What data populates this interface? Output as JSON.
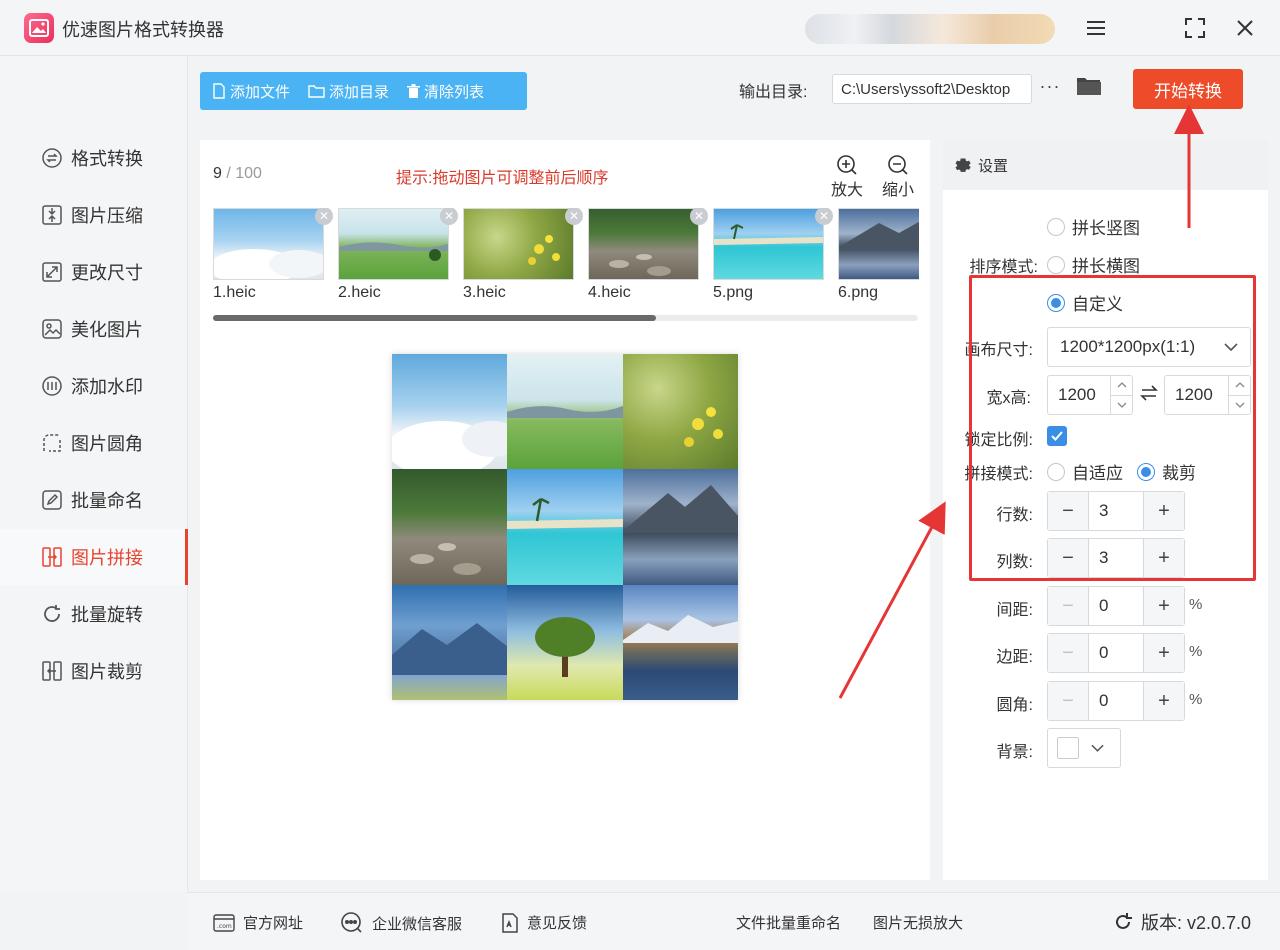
{
  "app": {
    "title": "优速图片格式转换器"
  },
  "sidebar": {
    "items": [
      {
        "label": "格式转换",
        "icon": "format-convert-icon"
      },
      {
        "label": "图片压缩",
        "icon": "compress-icon"
      },
      {
        "label": "更改尺寸",
        "icon": "resize-icon"
      },
      {
        "label": "美化图片",
        "icon": "beautify-icon"
      },
      {
        "label": "添加水印",
        "icon": "watermark-icon"
      },
      {
        "label": "图片圆角",
        "icon": "round-corner-icon"
      },
      {
        "label": "批量命名",
        "icon": "rename-icon"
      },
      {
        "label": "图片拼接",
        "icon": "stitch-icon",
        "active": true
      },
      {
        "label": "批量旋转",
        "icon": "rotate-icon"
      },
      {
        "label": "图片裁剪",
        "icon": "crop-icon"
      }
    ]
  },
  "toolbar": {
    "add_file": "添加文件",
    "add_dir": "添加目录",
    "clear_list": "清除列表"
  },
  "output": {
    "label": "输出目录:",
    "path": "C:\\Users\\yssoft2\\Desktop",
    "more": "···",
    "start": "开始转换"
  },
  "main": {
    "count": "9",
    "total": "100",
    "separator": " / ",
    "hint": "提示:拖动图片可调整前后顺序",
    "zoom_in": "放大",
    "zoom_out": "缩小",
    "files": [
      "1.heic",
      "2.heic",
      "3.heic",
      "4.heic",
      "5.png",
      "6.png"
    ]
  },
  "settings": {
    "title": "设置",
    "sort_label": "排序模式:",
    "sort_options": [
      "拼长竖图",
      "拼长横图",
      "自定义"
    ],
    "canvas_label": "画布尺寸:",
    "canvas_value": "1200*1200px(1:1)",
    "wh_label": "宽x高:",
    "width": "1200",
    "height": "1200",
    "lock_label": "锁定比例:",
    "stitch_label": "拼接模式:",
    "stitch_options": [
      "自适应",
      "裁剪"
    ],
    "rows_label": "行数:",
    "rows": "3",
    "cols_label": "列数:",
    "cols": "3",
    "spacing_label": "间距:",
    "spacing": "0",
    "margin_label": "边距:",
    "margin": "0",
    "radius_label": "圆角:",
    "radius": "0",
    "bg_label": "背景:",
    "percent": "%",
    "minus": "−",
    "plus": "+"
  },
  "footer": {
    "website": "官方网址",
    "wechat": "企业微信客服",
    "feedback": "意见反馈",
    "batch_rename": "文件批量重命名",
    "lossless": "图片无损放大",
    "version": "版本: v2.0.7.0"
  },
  "colors": {
    "accent_red": "#ee4b2b",
    "accent_blue": "#4ab3f4",
    "radio_blue": "#3a8ee6",
    "highlight_box": "#e53535"
  }
}
